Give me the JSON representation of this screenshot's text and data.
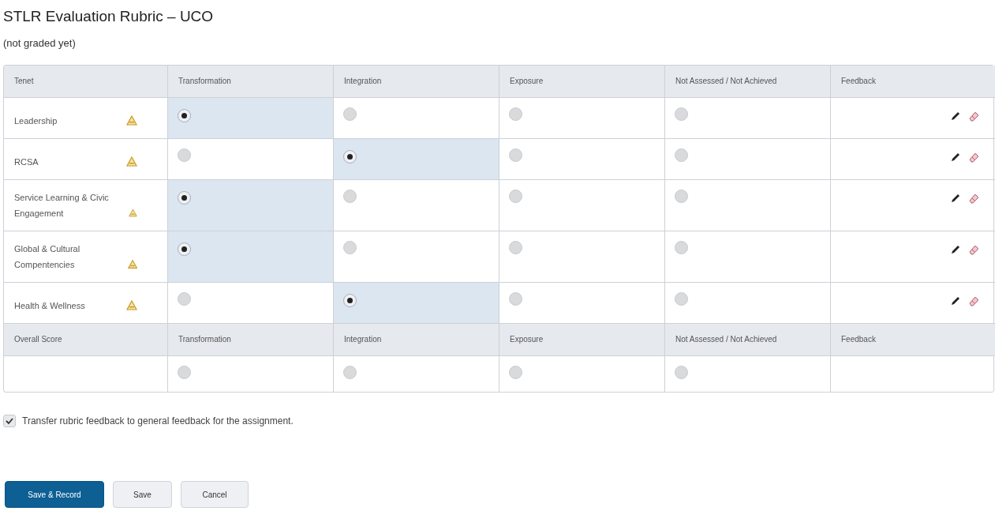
{
  "title": "STLR Evaluation Rubric – UCO",
  "status": "(not graded yet)",
  "table": {
    "columns": [
      "Tenet",
      "Transformation",
      "Integration",
      "Exposure",
      "Not Assessed / Not Achieved",
      "Feedback"
    ],
    "rows": [
      {
        "name": "Leadership",
        "warning": true,
        "levels": [
          {
            "selected": true
          },
          {
            "selected": false
          },
          {
            "selected": false
          },
          {
            "selected": false
          }
        ]
      },
      {
        "name": "RCSA",
        "warning": true,
        "levels": [
          {
            "selected": false
          },
          {
            "selected": true
          },
          {
            "selected": false
          },
          {
            "selected": false
          }
        ]
      },
      {
        "name": "Service Learning & Civic Engagement",
        "warning": true,
        "levels": [
          {
            "selected": true
          },
          {
            "selected": false
          },
          {
            "selected": false
          },
          {
            "selected": false
          }
        ]
      },
      {
        "name": "Global & Cultural Compentencies",
        "warning": true,
        "levels": [
          {
            "selected": true
          },
          {
            "selected": false
          },
          {
            "selected": false
          },
          {
            "selected": false
          }
        ]
      },
      {
        "name": "Health & Wellness",
        "warning": true,
        "levels": [
          {
            "selected": false
          },
          {
            "selected": true
          },
          {
            "selected": false
          },
          {
            "selected": false
          }
        ]
      }
    ],
    "overall": {
      "columns": [
        "Overall Score",
        "Transformation",
        "Integration",
        "Exposure",
        "Not Assessed / Not Achieved",
        "Feedback"
      ],
      "levels": [
        {
          "selected": false
        },
        {
          "selected": false
        },
        {
          "selected": false
        },
        {
          "selected": false
        }
      ]
    }
  },
  "transfer": {
    "label": "Transfer rubric feedback to general feedback for the assignment.",
    "checked": true
  },
  "buttons": [
    {
      "label": "Save & Record",
      "kind": "primary"
    },
    {
      "label": "Save",
      "kind": "secondary"
    },
    {
      "label": "Cancel",
      "kind": "secondary"
    }
  ]
}
